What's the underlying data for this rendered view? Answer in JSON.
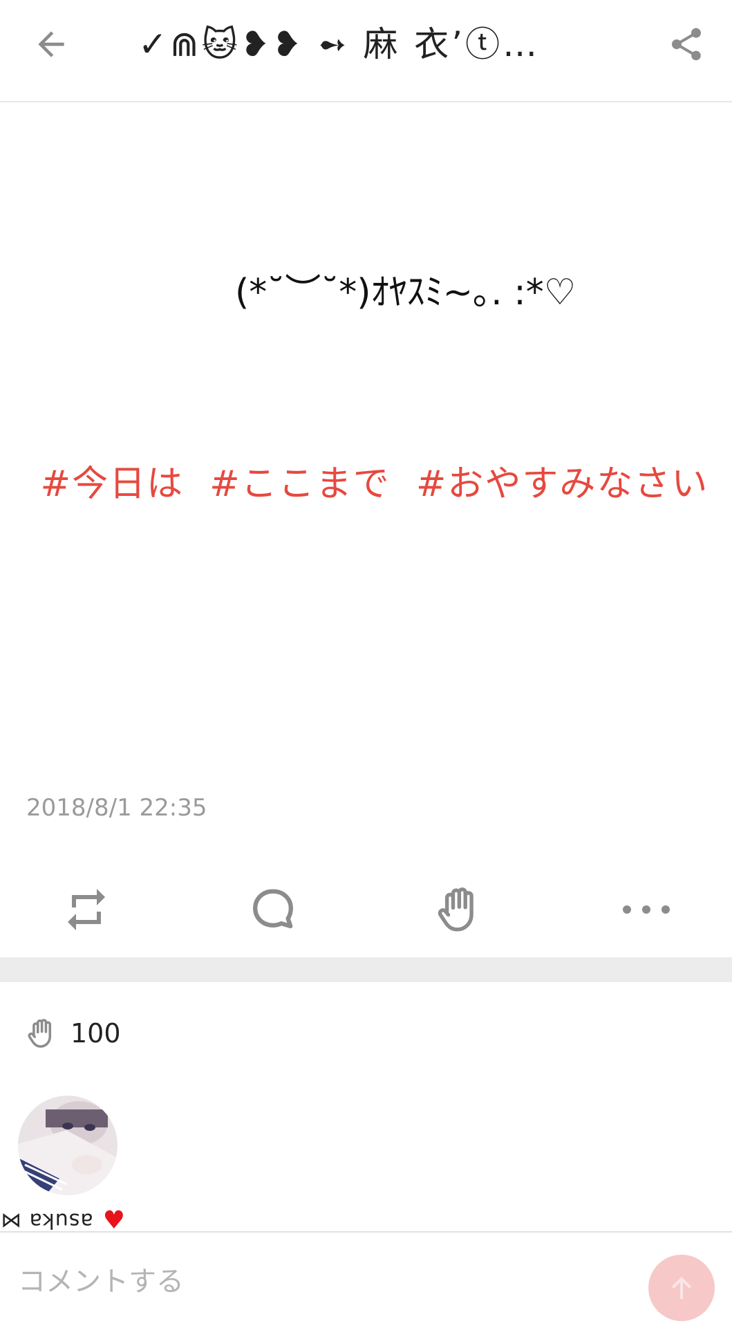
{
  "header": {
    "title": "✓⋒🐱❥❥ ➻ 麻 衣’ⓣ…",
    "back_icon": "arrow-left-icon",
    "share_icon": "share-icon"
  },
  "post": {
    "text": "(*˘︶˘*)ｵﾔｽﾐ~｡. :*♡",
    "hashtags": [
      "#今日は",
      "#ここまで",
      "#おやすみなさい"
    ],
    "timestamp": "2018/8/1 22:35"
  },
  "actions": [
    {
      "id": "repost",
      "icon": "repost-icon"
    },
    {
      "id": "comment",
      "icon": "comment-bubble-icon"
    },
    {
      "id": "clap",
      "icon": "clap-hand-icon"
    },
    {
      "id": "more",
      "icon": "more-dots-icon"
    }
  ],
  "claps": {
    "count": "100",
    "icon": "clap-hand-icon"
  },
  "clapper": {
    "name": "asuka ⋈",
    "heart": "♥"
  },
  "comment": {
    "placeholder": "コメントする",
    "send_icon": "arrow-up-icon"
  },
  "colors": {
    "hashtag": "#e6493f",
    "timestamp": "#9a9a9a",
    "icon_gray": "#8c8c8c",
    "send_button": "#f7c8c8",
    "heart": "#e8141b",
    "divider": "#ececec"
  }
}
